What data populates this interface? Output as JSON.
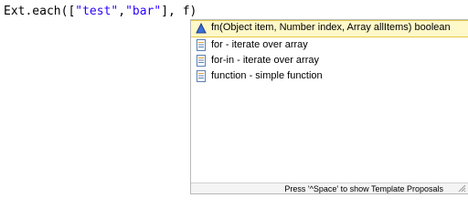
{
  "editor": {
    "code_prefix": "Ext.each([",
    "string_one": "\"test\"",
    "comma": ",",
    "string_two": "\"bar\"",
    "code_suffix": "], f)"
  },
  "autocomplete": {
    "proposals": [
      {
        "label": "fn(Object item, Number index, Array allItems) boolean",
        "icon": "method-icon",
        "selected": true
      },
      {
        "label": "for - iterate over array",
        "icon": "template-icon",
        "selected": false
      },
      {
        "label": "for-in - iterate over array",
        "icon": "template-icon",
        "selected": false
      },
      {
        "label": "function - simple function",
        "icon": "template-icon",
        "selected": false
      }
    ],
    "status_hint": "Press '^Space' to show Template Proposals"
  },
  "colors": {
    "string_literal": "#2a00ff",
    "selection_background": "#fff8c8",
    "selection_border": "#e6c84a"
  }
}
